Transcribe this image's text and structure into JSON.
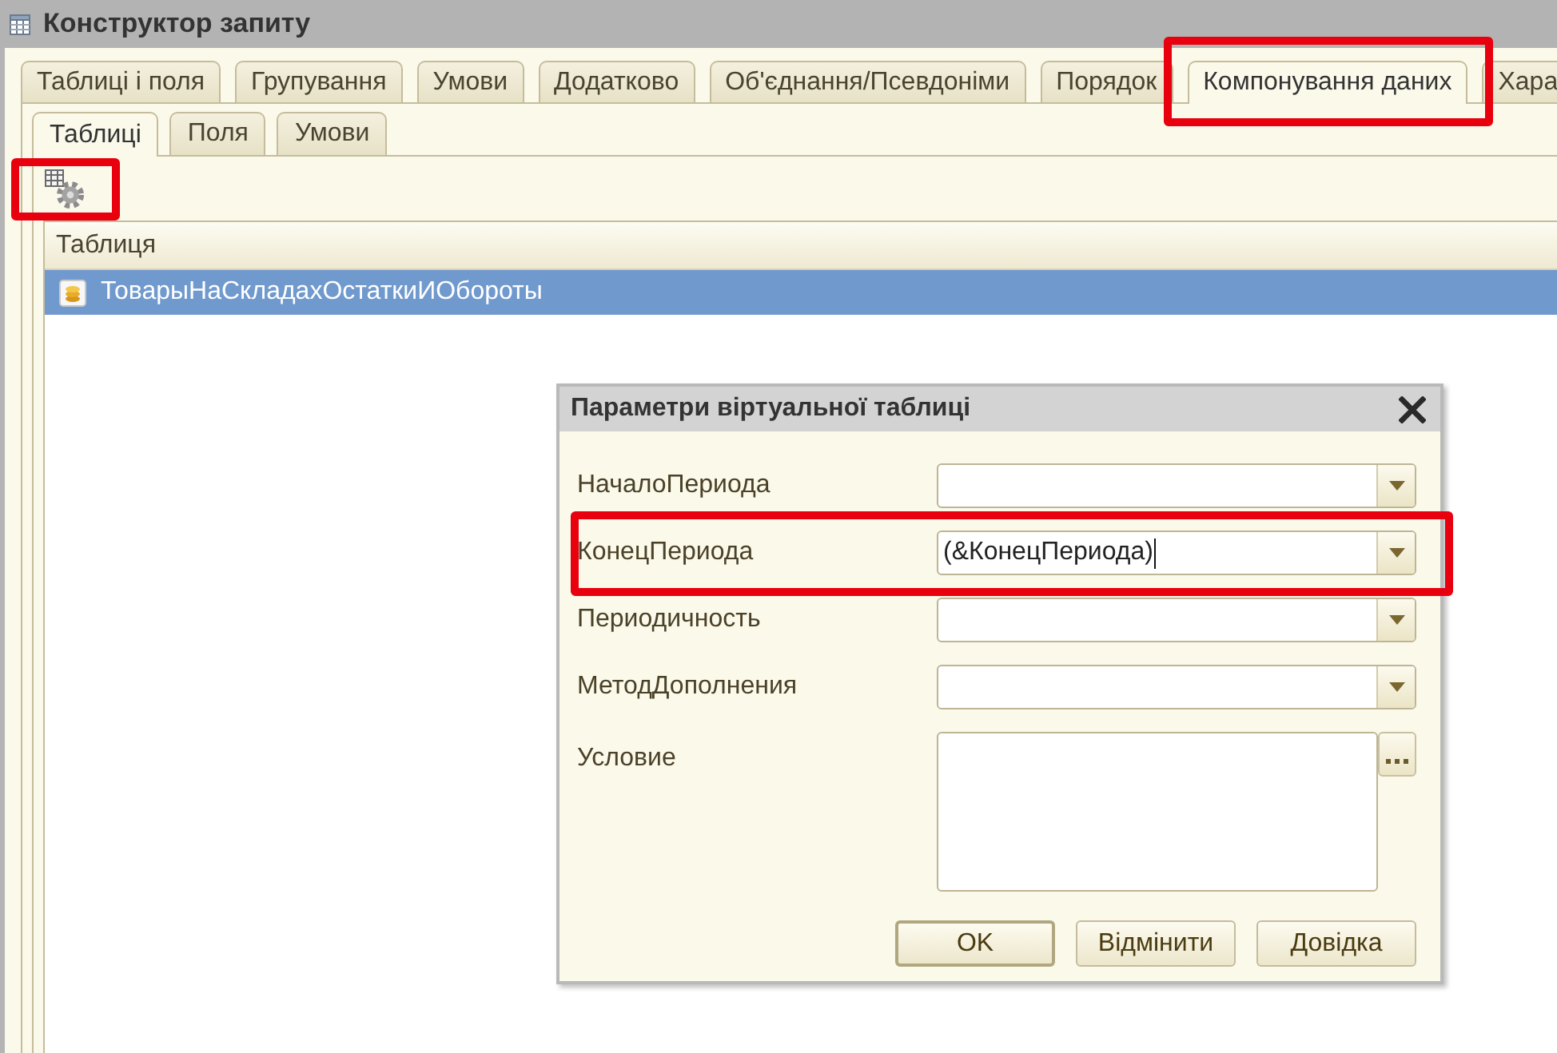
{
  "window": {
    "title": "Конструктор запиту"
  },
  "tabs": [
    {
      "label": "Таблиці і поля",
      "selected": false,
      "highlighted": false
    },
    {
      "label": "Групування",
      "selected": false,
      "highlighted": false
    },
    {
      "label": "Умови",
      "selected": false,
      "highlighted": false
    },
    {
      "label": "Додатково",
      "selected": false,
      "highlighted": false
    },
    {
      "label": "Об'єднання/Псевдоніми",
      "selected": false,
      "highlighted": false
    },
    {
      "label": "Порядок",
      "selected": false,
      "highlighted": false
    },
    {
      "label": "Компонування даних",
      "selected": true,
      "highlighted": true
    },
    {
      "label": "Хара",
      "selected": false,
      "highlighted": false
    }
  ],
  "subtabs": [
    {
      "label": "Таблиці",
      "selected": true
    },
    {
      "label": "Поля",
      "selected": false
    },
    {
      "label": "Умови",
      "selected": false
    }
  ],
  "toolbar_button": {
    "highlighted": true
  },
  "table": {
    "columns": [
      "Таблиця"
    ],
    "rows": [
      {
        "cells": [
          "ТоварыНаСкладахОстаткиИОбороты"
        ],
        "selected": true
      }
    ]
  },
  "dialog": {
    "title": "Параметри віртуальної таблиці",
    "fields": [
      {
        "label": "НачалоПериода",
        "kind": "dropdown",
        "focused": false,
        "highlighted": false
      },
      {
        "label": "КонецПериода",
        "kind": "dropdown",
        "value": "(&КонецПериода)",
        "focused": true,
        "highlighted": true
      },
      {
        "label": "Периодичность",
        "kind": "dropdown",
        "focused": false,
        "highlighted": false
      },
      {
        "label": "МетодДополнения",
        "kind": "dropdown",
        "focused": false,
        "highlighted": false
      },
      {
        "label": "Условие",
        "kind": "textarea",
        "focused": false,
        "highlighted": false
      }
    ],
    "buttons": [
      {
        "label": "OK",
        "default": true
      },
      {
        "label": "Відмінити",
        "default": false
      },
      {
        "label": "Довідка",
        "default": false
      }
    ]
  }
}
